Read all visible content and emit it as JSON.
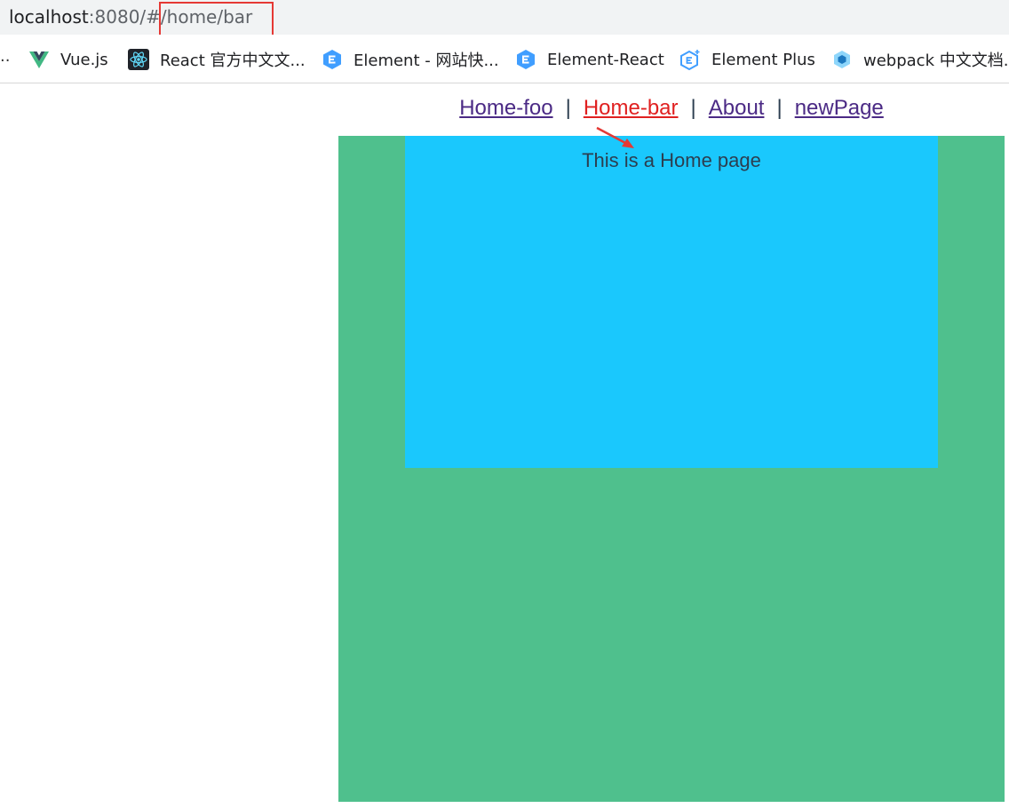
{
  "address_bar": {
    "host": "localhost",
    "rest": ":8080/#/home/bar"
  },
  "bookmarks": {
    "overflow": "..",
    "items": [
      {
        "label": "Vue.js",
        "icon": "vue-icon"
      },
      {
        "label": "React 官方中文文...",
        "icon": "react-icon"
      },
      {
        "label": "Element - 网站快...",
        "icon": "element-icon"
      },
      {
        "label": "Element-React",
        "icon": "element-icon"
      },
      {
        "label": "Element Plus",
        "icon": "element-plus-icon"
      },
      {
        "label": "webpack 中文文档..",
        "icon": "webpack-icon"
      }
    ]
  },
  "nav": {
    "links": [
      "Home-foo",
      "Home-bar",
      "About",
      "newPage"
    ],
    "active": "Home-bar",
    "separator": "|"
  },
  "page": {
    "home_text": "This is a Home page"
  },
  "colors": {
    "green": "#4fc08d",
    "blue": "#1ac8fd",
    "active_link": "#e02020",
    "link": "#4b2a85",
    "annotation_red": "#e53935"
  }
}
